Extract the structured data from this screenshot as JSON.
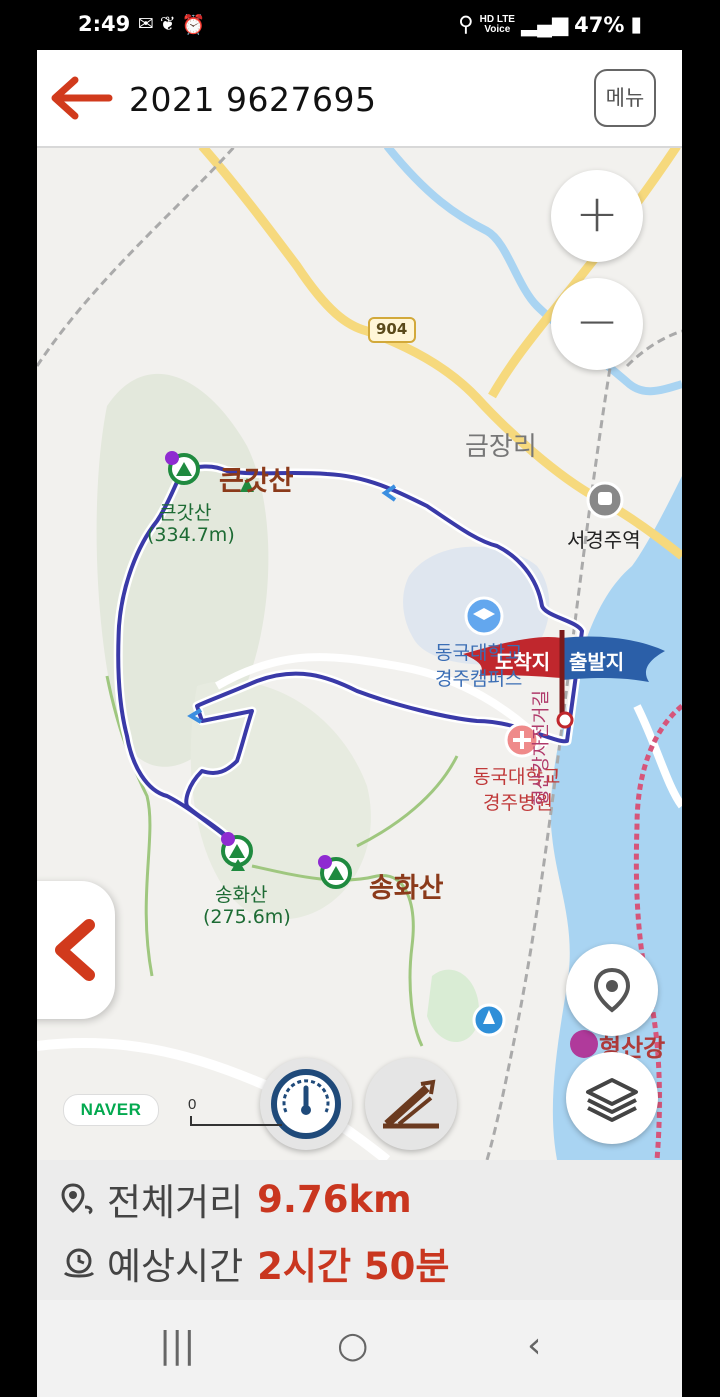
{
  "status_bar": {
    "time": "2:49",
    "battery": "47%",
    "network_top": "HD LTE",
    "network_bottom": "Voice",
    "icons": [
      "mail-icon",
      "leaf-icon",
      "alarm-icon",
      "location-icon",
      "signal-icon",
      "battery-icon"
    ]
  },
  "header": {
    "title": "2021 9627695",
    "menu_label": "메뉴",
    "back_icon": "arrow-left-icon"
  },
  "map": {
    "road_number": "904",
    "places": {
      "village": "금장리",
      "peak_big_name": "큰갓산",
      "peak_big_label": "큰갓산",
      "peak_big_elev": "(334.7m)",
      "peak_song_name": "송화산",
      "peak_song_label": "송화산",
      "peak_song_elev": "(275.6m)",
      "station": "서경주역",
      "university_line1": "동국대학교",
      "university_line2": "경주캠퍼스",
      "hospital_line1": "동국대학교",
      "hospital_line2": "경주병원",
      "bike_road": "형산강자전거길",
      "river_label": "형산강"
    },
    "flags": {
      "arrive": "도착지",
      "depart": "출발지"
    },
    "naver_logo": "NAVER",
    "scale_label": "0",
    "colors": {
      "route": "#3a3aa8",
      "arrive_flag": "#c0272d",
      "depart_flag": "#2b5fa8",
      "accent": "#c9361f"
    }
  },
  "info": {
    "distance_label": "전체거리",
    "distance_value": "9.76km",
    "time_label": "예상시간",
    "time_value": "2시간 50분"
  },
  "nav_bar": {
    "recents": "|||",
    "home": "○",
    "back": "‹"
  }
}
